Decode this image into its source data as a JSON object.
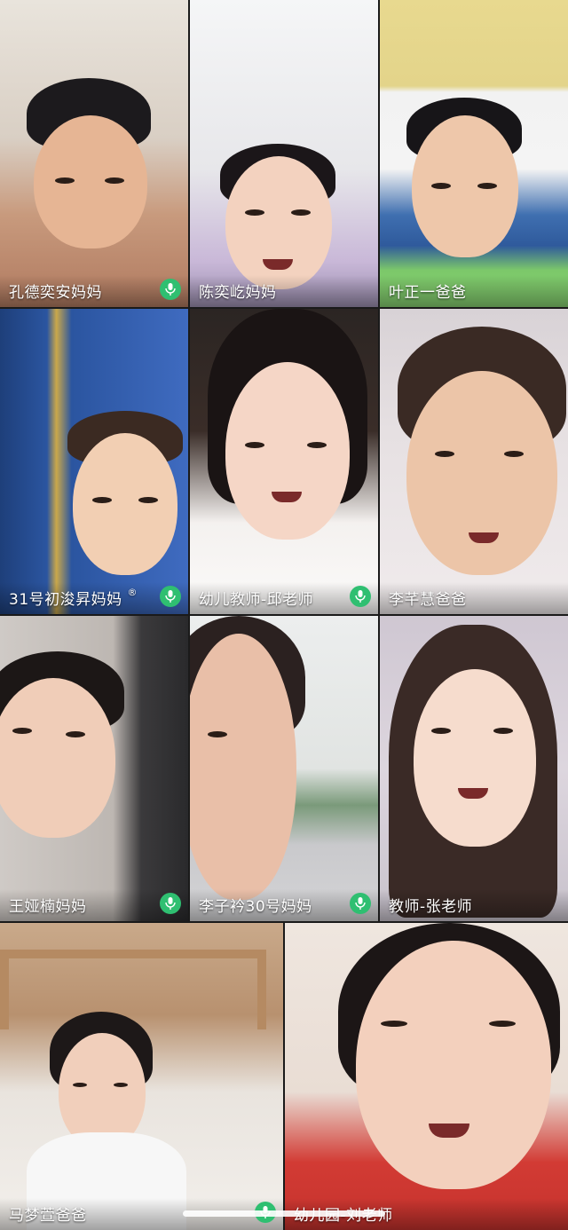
{
  "participants": [
    {
      "name": "孔德奕安妈妈",
      "mic": true
    },
    {
      "name": "陈奕屹妈妈",
      "mic": false
    },
    {
      "name": "叶正一爸爸",
      "mic": false
    },
    {
      "name": "31号初浚昇妈妈",
      "mic": true,
      "badge": "®"
    },
    {
      "name": "幼儿教师-邱老师",
      "mic": true
    },
    {
      "name": "李芊慧爸爸",
      "mic": false
    },
    {
      "name": "王娅楠妈妈",
      "mic": true
    },
    {
      "name": "李子衿30号妈妈",
      "mic": true
    },
    {
      "name": "教师-张老师",
      "mic": false
    },
    {
      "name": "马梦萱爸爸",
      "mic": true
    },
    {
      "name": "幼儿园-刘老师",
      "mic": false
    }
  ],
  "icons": {
    "mic": "microphone-icon"
  },
  "colors": {
    "mic_active": "#2fbf71",
    "label_text": "#ffffff"
  }
}
